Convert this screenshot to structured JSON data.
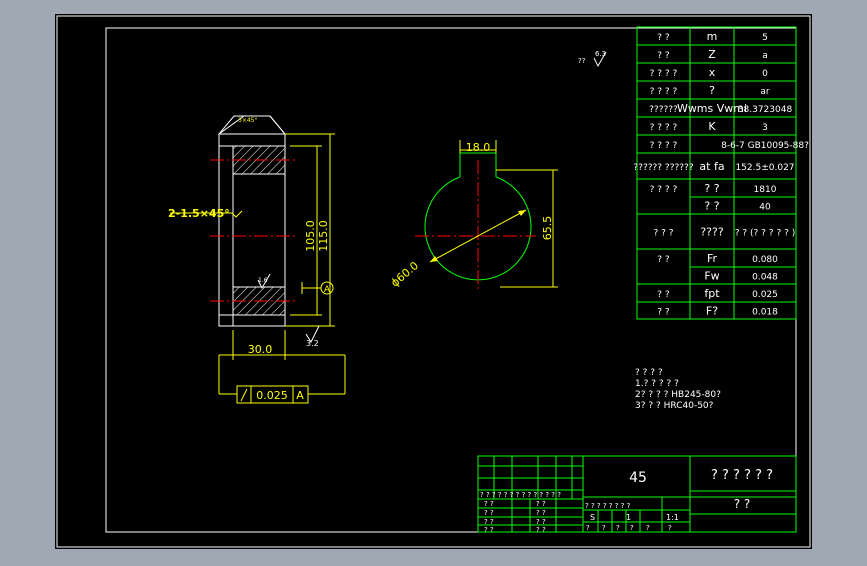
{
  "colors": {
    "frame_bg": "#a0a8b4",
    "canvas": "#000000",
    "border": "#ffffff",
    "table": "#00ff00",
    "dim": "#ffff00",
    "center": "#ff0000",
    "part": "#ffffff"
  },
  "notes": {
    "chamfer_small": "3×45°",
    "chamfer": "2-1.5×45°",
    "dim_105": "105.0",
    "dim_115": "115.0",
    "dim_30": "30.0",
    "tol_value": "0.025",
    "tol_ref": "A",
    "datum": "A",
    "rough_32": "3.2",
    "rough_16": "1.6",
    "rough_63": "6.3",
    "rough_prefix": "??",
    "key_width": "18.0",
    "key_depth": "65.5",
    "bore_dia": "ϕ60.0"
  },
  "spec_table": [
    {
      "c1": "? ?",
      "c2": "m",
      "c3": "5"
    },
    {
      "c1": "? ?",
      "c2": "Z",
      "c3": "a"
    },
    {
      "c1": "? ? ? ?",
      "c2": "x",
      "c3": "0"
    },
    {
      "c1": "? ? ? ?",
      "c2": "?",
      "c3": "ar"
    },
    {
      "c1": "??????",
      "c2": "Wwms Vwmi",
      "c3": "38.3723048"
    },
    {
      "c1": "? ? ? ?",
      "c2": "K",
      "c3": "3"
    },
    {
      "c1": "? ? ? ?",
      "c2": "",
      "c3": "8-6-7 GB10095-88?"
    },
    {
      "c1": "?????? ??????",
      "c2": "at fa",
      "c3": "152.5±0.027"
    },
    {
      "c1": "? ? ? ?",
      "c2": "? ?",
      "c3": "1810"
    },
    {
      "c1": "",
      "c2": "? ?",
      "c3": "40"
    },
    {
      "c1": "? ? ?",
      "c2": "????",
      "c3": "? ? (? ? ? ? ? )"
    },
    {
      "c1": "? ?",
      "c2": "Fr",
      "c3": "0.080"
    },
    {
      "c1": "",
      "c2": "Fw",
      "c3": "0.048"
    },
    {
      "c1": "? ?",
      "c2": "fpt",
      "c3": "0.025"
    },
    {
      "c1": "? ?",
      "c2": "F?",
      "c3": "0.018"
    }
  ],
  "tech_notes": [
    "? ? ? ?",
    "1.? ? ? ? ?",
    "2? ? ? ? HB245-80?",
    "3? ? ? HRC40-50?"
  ],
  "title_block": {
    "material": "45",
    "drawing_name": "? ? ? ? ? ?",
    "company": "? ?",
    "header_row": "? ? ? ? ? ? ? ? ? ? ? ? ? ?",
    "scale_header": "? ? ? ? ? ? ? ?",
    "sheet_vals": [
      "S",
      "1",
      "1:1"
    ],
    "bottom_cells": [
      "?",
      "?",
      "?",
      "?",
      "?",
      "?"
    ],
    "left_labels": [
      "? ?",
      "? ?",
      "? ?",
      "? ?"
    ],
    "mid_labels": [
      "? ?",
      "? ?",
      "? ?",
      "? ?"
    ]
  }
}
